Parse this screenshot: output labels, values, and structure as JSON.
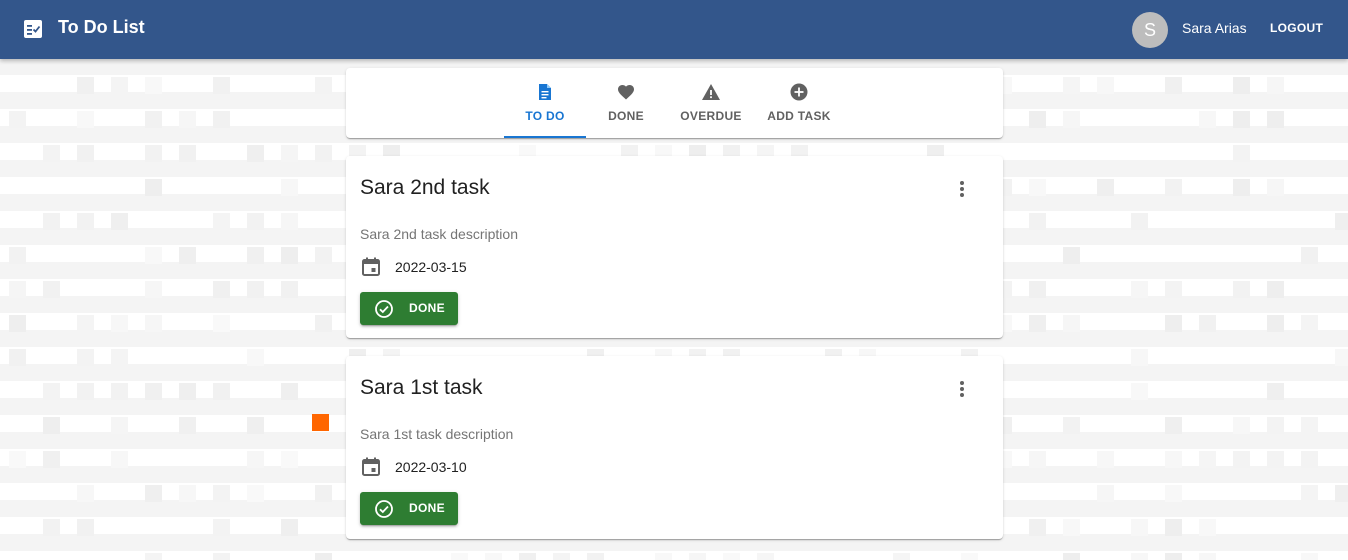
{
  "app": {
    "title": "To Do List",
    "user_initial": "S",
    "user_name": "Sara Arias",
    "logout_label": "LOGOUT",
    "brand_color": "#33568b"
  },
  "tabs": [
    {
      "label": "TO DO",
      "icon": "note-icon",
      "active": true
    },
    {
      "label": "DONE",
      "icon": "heart-icon",
      "active": false
    },
    {
      "label": "OVERDUE",
      "icon": "warning-icon",
      "active": false
    },
    {
      "label": "ADD TASK",
      "icon": "add-circle-icon",
      "active": false
    }
  ],
  "tasks": [
    {
      "title": "Sara 2nd task",
      "description": "Sara 2nd task description",
      "date": "2022-03-15",
      "button_label": "DONE"
    },
    {
      "title": "Sara 1st task",
      "description": "Sara 1st task description",
      "date": "2022-03-10",
      "button_label": "DONE"
    }
  ],
  "colors": {
    "accent": "#1976d2",
    "done_button": "#2e7d32"
  }
}
